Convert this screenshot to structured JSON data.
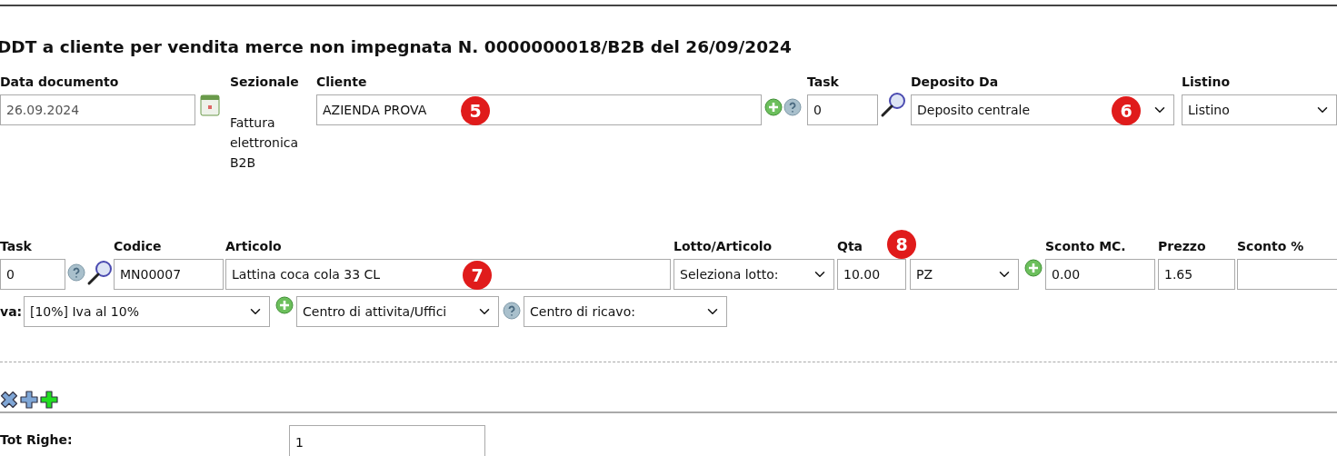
{
  "title": "DDT a cliente per vendita merce non impegnata N. 0000000018/B2B del 26/09/2024",
  "header": {
    "data_documento": {
      "label": "Data documento",
      "value": "26.09.2024",
      "disabled": true
    },
    "sezionale": {
      "label": "Sezionale",
      "value": "Fattura elettronica B2B"
    },
    "cliente": {
      "label": "Cliente",
      "value": "AZIENDA PROVA",
      "marker": "5"
    },
    "task": {
      "label": "Task",
      "value": "0"
    },
    "deposito_da": {
      "label": "Deposito Da",
      "value": "Deposito centrale",
      "marker": "6"
    },
    "listino": {
      "label": "Listino",
      "value": "Listino"
    }
  },
  "line_item": {
    "fields": [
      {
        "kind": "input",
        "label": "Task",
        "value": "0"
      },
      {
        "kind": "input",
        "label": "Codice",
        "value": "MN00007"
      },
      {
        "kind": "input",
        "label": "Articolo",
        "value": "Lattina coca cola 33 CL",
        "marker": "7"
      },
      {
        "kind": "select",
        "label": "Lotto/Articolo",
        "value": "Seleziona lotto:"
      },
      {
        "kind": "input",
        "label": "Qta",
        "value": "10.00",
        "marker": "8"
      },
      {
        "kind": "select",
        "value": "PZ"
      },
      {
        "kind": "input",
        "label": "Sconto MC.",
        "value": "0.00"
      },
      {
        "kind": "input",
        "label": "Prezzo",
        "value": "1.65"
      },
      {
        "kind": "input",
        "label": "Sconto %"
      }
    ],
    "iva_label": "va:",
    "selects": [
      {
        "value": "[10%] Iva al 10%"
      },
      {
        "value": "Centro di attivita/Uffici"
      },
      {
        "value": "Centro di ricavo:"
      }
    ]
  },
  "totals": {
    "label": "Tot Righe:",
    "value": "1"
  }
}
